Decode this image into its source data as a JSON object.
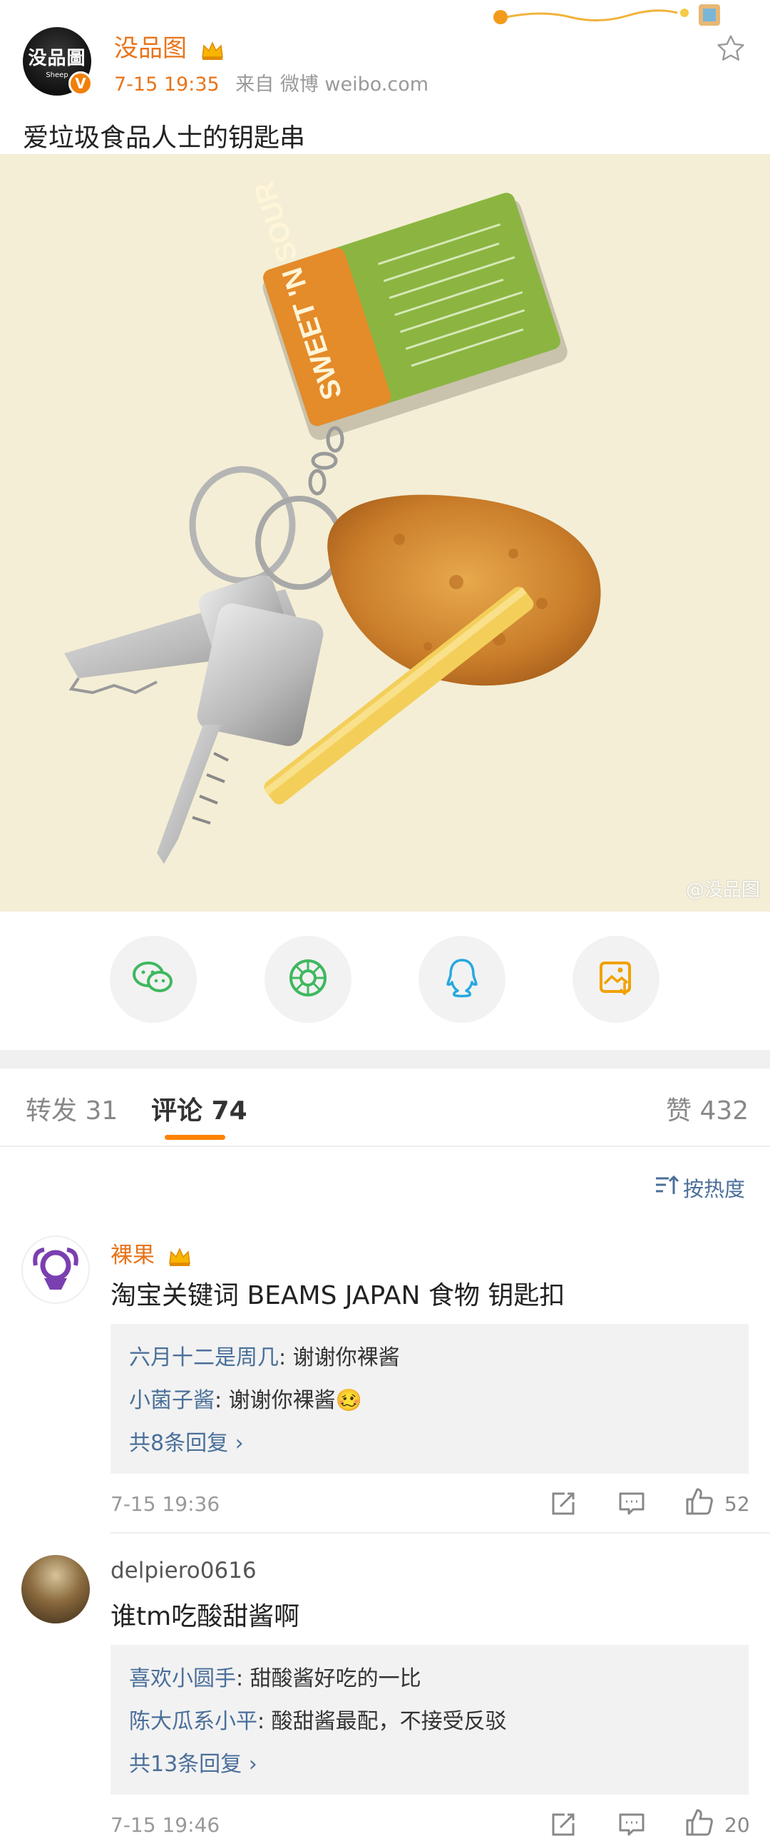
{
  "post": {
    "avatar_text": "没品圖",
    "avatar_sub": "Sheep",
    "verified_badge": "V",
    "author": "没品图",
    "time": "7-15 19:35",
    "source": "来自 微博 weibo.com",
    "text": "爱垃圾食品人士的钥匙串",
    "watermark": "@没品图",
    "sauce_label": "SWEET 'N SOUR"
  },
  "share": [
    {
      "name": "wechat",
      "color": "#3fb85f"
    },
    {
      "name": "moments",
      "color": "#3fb85f"
    },
    {
      "name": "qq",
      "color": "#26a8e0"
    },
    {
      "name": "save-image",
      "color": "#f1a100"
    }
  ],
  "tabs": {
    "repost": "转发 31",
    "comments": "评论 74",
    "likes": "赞 432"
  },
  "sort_label": "按热度",
  "comments": [
    {
      "name": "裸果",
      "text": "淘宝关键词 BEAMS JAPAN 食物 钥匙扣",
      "replies": [
        {
          "name": "六月十二是周几",
          "text": ": 谢谢你裸酱"
        },
        {
          "name": "小菌子酱",
          "text": ": 谢谢你裸酱🥴"
        }
      ],
      "more": "共8条回复 ›",
      "time": "7-15 19:36",
      "likes": "52"
    },
    {
      "name": "delpiero0616",
      "text": "谁tm吃酸甜酱啊",
      "replies": [
        {
          "name": "喜欢小圆手",
          "text": ": 甜酸酱好吃的一比"
        },
        {
          "name": "陈大瓜系小平",
          "text": ": 酸甜酱最配，不接受反驳"
        }
      ],
      "more": "共13条回复 ›",
      "time": "7-15 19:46",
      "likes": "20"
    }
  ],
  "colors": {
    "accent": "#ff8200",
    "author": "#e8741a",
    "link": "#4a6f9a"
  }
}
